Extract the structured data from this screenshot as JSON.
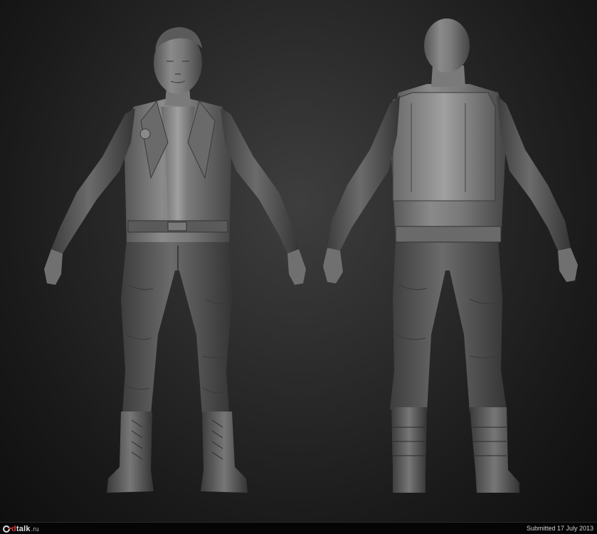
{
  "image": {
    "subject": "",
    "background": "#262626"
  },
  "footer": {
    "logo_prefix": "3d",
    "logo_accent": "d",
    "logo_main": "talk",
    "logo_domain": ".ru",
    "submitted": "Submitted 17 July 2013"
  }
}
